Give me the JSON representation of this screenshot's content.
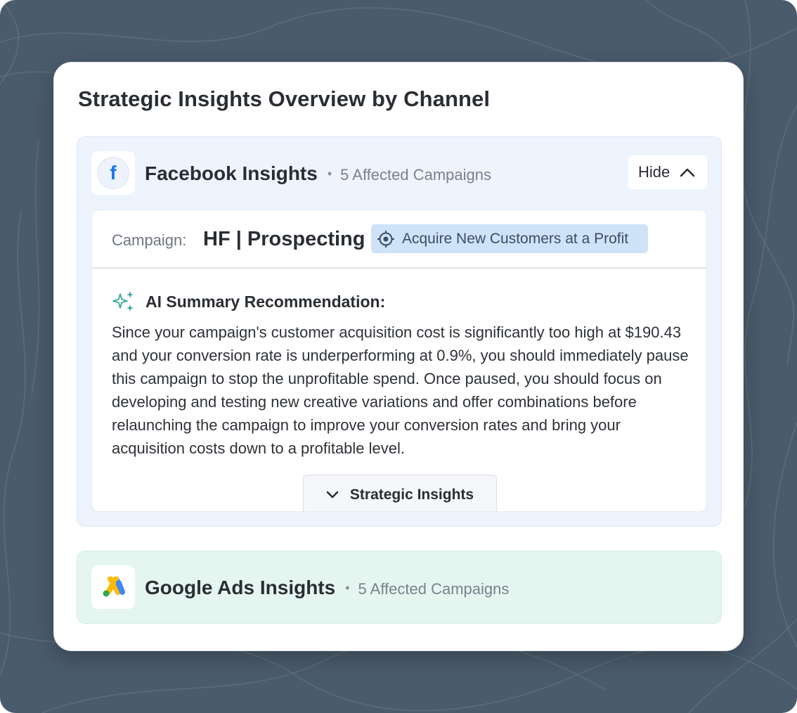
{
  "page": {
    "title": "Strategic Insights Overview by Channel"
  },
  "facebook": {
    "logo_letter": "f",
    "name": "Facebook Insights",
    "separator": "•",
    "affected": "5 Affected Campaigns",
    "hide_label": "Hide",
    "hide_icon": "chevron-up-icon",
    "campaign": {
      "label": "Campaign:",
      "name": "HF | Prospecting",
      "goal": "Acquire New Customers at a Profit",
      "goal_icon": "target-icon"
    },
    "ai": {
      "icon": "sparkles-icon",
      "title": "AI Summary Recommendation:",
      "text": "Since your campaign's customer acquisition cost is significantly too high at $190.43 and your conversion rate is underperforming at 0.9%, you should immediately pause this campaign to stop the unprofitable spend. Once paused, you should focus on developing and testing new creative variations and offer combinations before relaunching the campaign to improve your conversion rates and bring your acquisition costs down to a profitable level."
    },
    "strategic_button": {
      "label": "Strategic Insights",
      "icon": "chevron-down-icon"
    }
  },
  "google": {
    "name": "Google Ads Insights",
    "separator": "•",
    "affected": "5 Affected Campaigns",
    "logo_icon": "google-ads-icon"
  },
  "colors": {
    "background": "#4a5b6c",
    "facebook_blue": "#1877f2",
    "fb_section_bg": "#eef4fd",
    "google_section_bg": "#e5f6f1",
    "goal_badge_bg": "#cfe3f8",
    "sparkle": "#3aa89a"
  }
}
